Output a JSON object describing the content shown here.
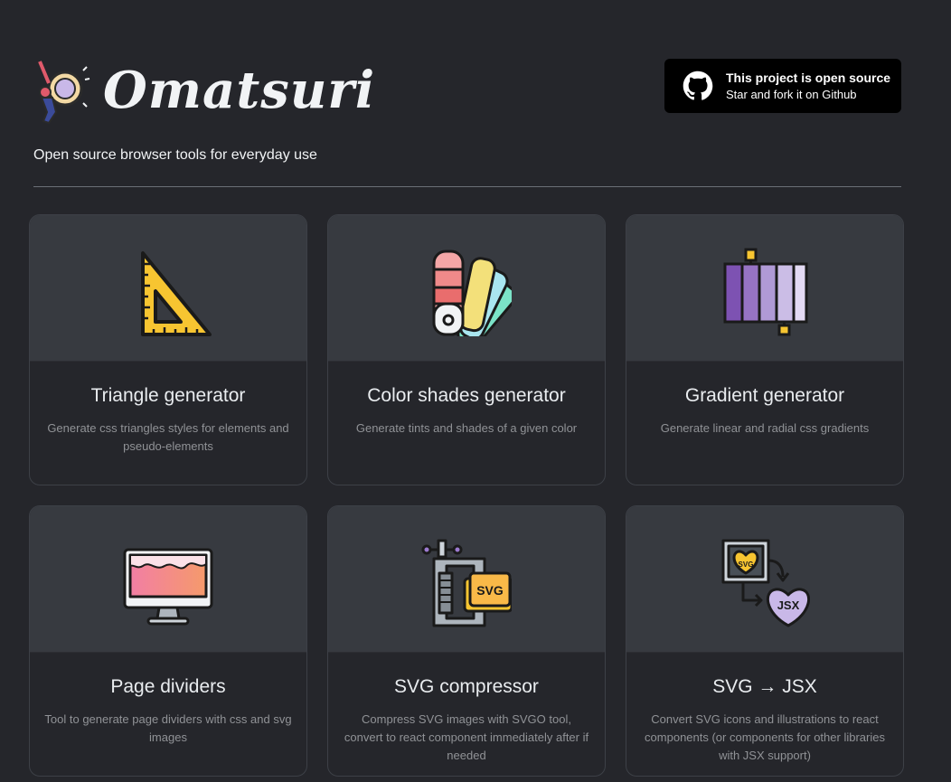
{
  "header": {
    "brand": "Omatsuri",
    "tagline": "Open source browser tools for everyday use",
    "github": {
      "title": "This project is open source",
      "subtitle": "Star and fork it on Github",
      "icon": "github-icon"
    }
  },
  "tools": [
    {
      "title": "Triangle generator",
      "description": "Generate css triangles styles for elements and pseudo-elements",
      "icon": "triangle-ruler-icon"
    },
    {
      "title": "Color shades generator",
      "description": "Generate tints and shades of a given color",
      "icon": "color-swatches-icon"
    },
    {
      "title": "Gradient generator",
      "description": "Generate linear and radial css gradients",
      "icon": "gradient-icon"
    },
    {
      "title": "Page dividers",
      "description": "Tool to generate page dividers with css and svg images",
      "icon": "monitor-wave-icon"
    },
    {
      "title": "SVG compressor",
      "description": "Compress SVG images with SVGO tool, convert to react component immediately after if needed",
      "icon": "svg-clamp-icon"
    },
    {
      "title": "SVG → JSX",
      "description": "Convert SVG icons and illustrations to react components (or components for other libraries with JSX support)",
      "icon": "svg-to-jsx-icon"
    }
  ],
  "icon_text": {
    "svg_badge": "SVG",
    "svg_heart": "SVG",
    "jsx_heart": "JSX"
  },
  "colors": {
    "background": "#25262b",
    "card_top": "#373a40",
    "description": "#909296"
  }
}
